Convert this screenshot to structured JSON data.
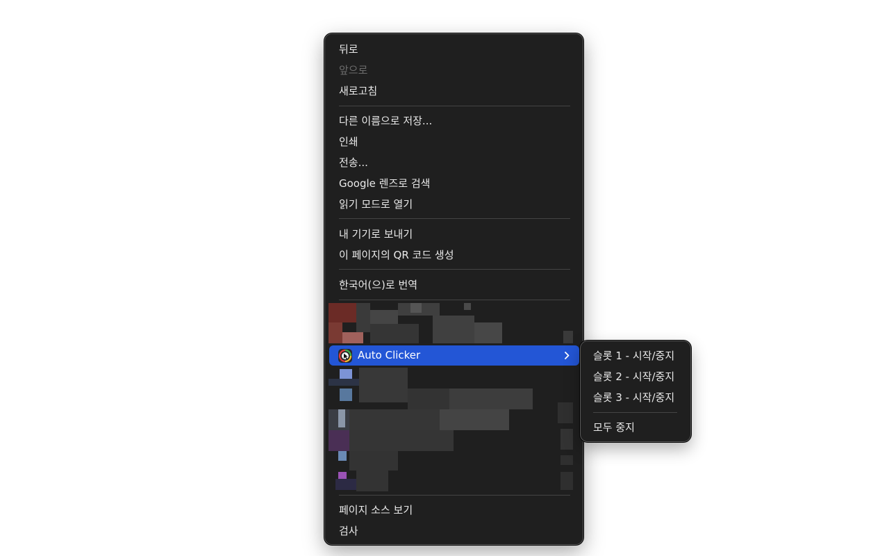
{
  "context_menu": {
    "groups": [
      {
        "items": [
          {
            "label": "뒤로",
            "enabled": true
          },
          {
            "label": "앞으로",
            "enabled": false
          },
          {
            "label": "새로고침",
            "enabled": true
          }
        ]
      },
      {
        "items": [
          {
            "label": "다른 이름으로 저장...",
            "enabled": true
          },
          {
            "label": "인쇄",
            "enabled": true
          },
          {
            "label": "전송...",
            "enabled": true
          },
          {
            "label": "Google 렌즈로 검색",
            "enabled": true
          },
          {
            "label": "읽기 모드로 열기",
            "enabled": true
          }
        ]
      },
      {
        "items": [
          {
            "label": "내 기기로 보내기",
            "enabled": true
          },
          {
            "label": "이 페이지의 QR 코드 생성",
            "enabled": true
          }
        ]
      },
      {
        "items": [
          {
            "label": "한국어(으)로 번역",
            "enabled": true
          }
        ]
      },
      {
        "items": [
          {
            "label": "Auto Clicker",
            "icon": "auto-clicker-icon",
            "has_submenu": true,
            "highlighted": true
          }
        ]
      },
      {
        "items": [
          {
            "label": "페이지 소스 보기",
            "enabled": true
          },
          {
            "label": "검사",
            "enabled": true
          }
        ]
      }
    ]
  },
  "submenu": {
    "items": [
      {
        "label": "슬롯 1 - 시작/중지"
      },
      {
        "label": "슬롯 2 - 시작/중지"
      },
      {
        "label": "슬롯 3 - 시작/중지"
      },
      {
        "label": "모두 중지"
      }
    ]
  },
  "colors": {
    "menu_bg": "#1f1f1f",
    "highlight": "#2356d6",
    "text": "#e9e9e9",
    "disabled_text": "#6c6c6c",
    "separator": "#444444"
  }
}
